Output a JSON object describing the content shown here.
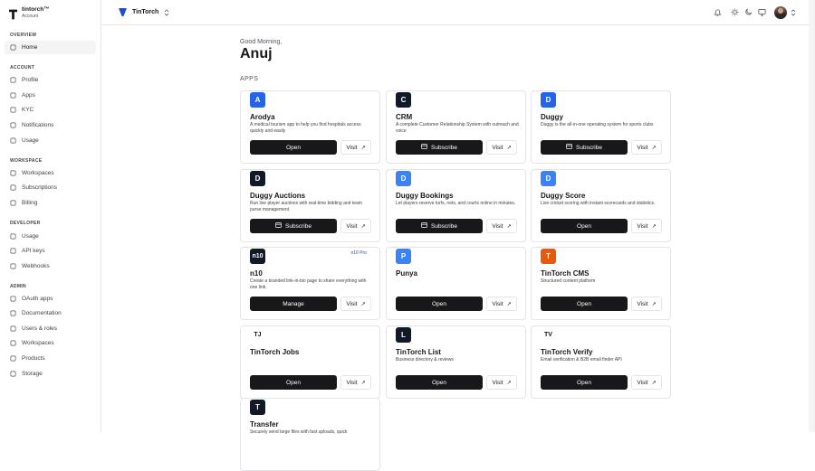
{
  "brand": {
    "name": "tintorch™",
    "sub": "Account"
  },
  "sidebar": {
    "sections": [
      {
        "title": "OVERVIEW",
        "items": [
          {
            "label": "Home",
            "icon": "grid-icon"
          }
        ]
      },
      {
        "title": "ACCOUNT",
        "items": [
          {
            "label": "Profile",
            "icon": "user-icon"
          },
          {
            "label": "Apps",
            "icon": "apps-icon"
          },
          {
            "label": "KYC",
            "icon": "shield-icon"
          },
          {
            "label": "Notifications",
            "icon": "bell-icon"
          },
          {
            "label": "Usage",
            "icon": "chart-icon"
          }
        ]
      },
      {
        "title": "WORKSPACE",
        "items": [
          {
            "label": "Workspaces",
            "icon": "users-icon"
          },
          {
            "label": "Subscriptions",
            "icon": "card-icon"
          },
          {
            "label": "Billing",
            "icon": "receipt-icon"
          }
        ]
      },
      {
        "title": "DEVELOPER",
        "items": [
          {
            "label": "Usage",
            "icon": "chart-icon"
          },
          {
            "label": "API keys",
            "icon": "key-icon"
          },
          {
            "label": "Webhooks",
            "icon": "webhook-icon"
          }
        ]
      },
      {
        "title": "ADMIN",
        "items": [
          {
            "label": "OAuth apps",
            "icon": "lock-icon"
          },
          {
            "label": "Documentation",
            "icon": "book-icon"
          },
          {
            "label": "Users & roles",
            "icon": "users-icon"
          },
          {
            "label": "Workspaces",
            "icon": "users-icon"
          },
          {
            "label": "Products",
            "icon": "box-icon"
          },
          {
            "label": "Storage",
            "icon": "database-icon"
          }
        ]
      }
    ]
  },
  "topbar": {
    "workspace": "TinTorch"
  },
  "main": {
    "greeting": "Good Morning,",
    "user": "Anuj",
    "apps_title": "APPS"
  },
  "apps": [
    {
      "name": "Arodya",
      "desc": "A medical tourism app to help you find hospitals access quickly and easily",
      "action": "Open",
      "visit": "Visit",
      "logo": "A",
      "logo_color": "#2563eb"
    },
    {
      "name": "CRM",
      "desc": "A complete Customer Relationship System with outreach and voice",
      "action": "Subscribe",
      "visit": "Visit",
      "logo": "C",
      "logo_color": "#111827"
    },
    {
      "name": "Duggy",
      "desc": "Duggy is the all-in-one operating system for sports clubs",
      "action": "Subscribe",
      "visit": "Visit",
      "logo": "D",
      "logo_color": "#2563eb"
    },
    {
      "name": "Duggy Auctions",
      "desc": "Run live player auctions with real-time bidding and team purse management.",
      "action": "Subscribe",
      "visit": "Visit",
      "logo": "D",
      "logo_color": "#111827"
    },
    {
      "name": "Duggy Bookings",
      "desc": "Let players reserve turfs, nets, and courts online in minutes.",
      "action": "Subscribe",
      "visit": "Visit",
      "logo": "D",
      "logo_color": "#3b82f6"
    },
    {
      "name": "Duggy Score",
      "desc": "Live cricket scoring with instant scorecards and statistics.",
      "action": "Open",
      "visit": "Visit",
      "logo": "D",
      "logo_color": "#3b82f6"
    },
    {
      "name": "n10",
      "desc": "Create a branded link-in-bio page to share everything with one link.",
      "action": "Manage",
      "visit": "Visit",
      "logo": "n10",
      "logo_color": "#111827",
      "badge": "n10 Pro"
    },
    {
      "name": "Punya",
      "desc": "",
      "action": "Open",
      "visit": "Visit",
      "logo": "P",
      "logo_color": "#3b82f6"
    },
    {
      "name": "TinTorch CMS",
      "desc": "Structured content platform",
      "action": "Open",
      "visit": "Visit",
      "logo": "T",
      "logo_color": "#ea580c"
    },
    {
      "name": "TinTorch Jobs",
      "desc": "",
      "action": "Open",
      "visit": "Visit",
      "logo": "TJ",
      "logo_color": "#ffffff"
    },
    {
      "name": "TinTorch List",
      "desc": "Business directory & reviews",
      "action": "Open",
      "visit": "Visit",
      "logo": "L",
      "logo_color": "#111827"
    },
    {
      "name": "TinTorch Verify",
      "desc": "Email verification & B2B email finder API",
      "action": "Open",
      "visit": "Visit",
      "logo": "TV",
      "logo_color": "#ffffff"
    },
    {
      "name": "Transfer",
      "desc": "Securely send large files with fast uploads, quick",
      "action": "",
      "visit": "",
      "logo": "T",
      "logo_color": "#111827"
    }
  ]
}
